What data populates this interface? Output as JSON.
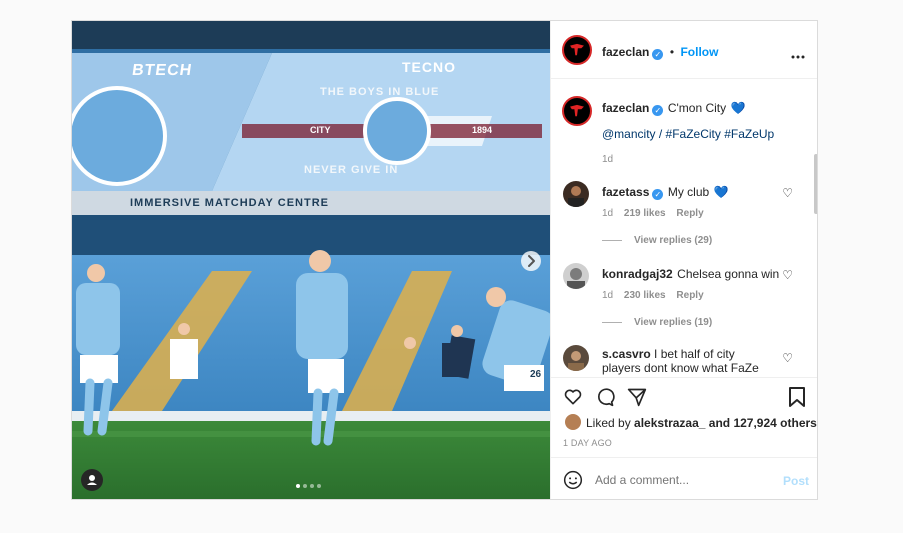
{
  "header": {
    "username": "fazeclan",
    "separator": "•",
    "follow_label": "Follow",
    "more_icon": "more-horizontal-icon"
  },
  "caption": {
    "username": "fazeclan",
    "text": "C'mon City",
    "heart": "💙",
    "tags": "@mancity / #FaZeCity #FaZeUp",
    "time": "1d"
  },
  "comments": [
    {
      "username": "fazetass",
      "text": "My club",
      "heart": "💙",
      "time": "1d",
      "likes": "219 likes",
      "reply": "Reply",
      "view_replies": "View replies (29)"
    },
    {
      "username": "konradgaj32",
      "text": "Chelsea gonna win",
      "time": "1d",
      "likes": "230 likes",
      "reply": "Reply",
      "view_replies": "View replies (19)"
    },
    {
      "username": "s.casvro",
      "text": "I bet half of city players dont know what FaZe clan is"
    }
  ],
  "likes": {
    "prefix": "Liked by",
    "user": "alekstrazaa_",
    "suffix": "and 127,924 others"
  },
  "timestamp": "1 DAY AGO",
  "add_comment": {
    "placeholder": "Add a comment...",
    "post_label": "Post"
  },
  "media": {
    "stand_banner_left": "BTECH",
    "stand_banner_right": "TECNO",
    "stand_text_1": "THE BOYS IN BLUE",
    "stand_text_2": "CITY",
    "stand_text_3": "1894",
    "stand_text_4": "NEVER GIVE IN",
    "board_text": "IMMERSIVE MATCHDAY CENTRE",
    "jersey_number": "26",
    "next_icon": "chevron-right-icon",
    "user_tag_icon": "user-tag-icon",
    "carousel_count": 4,
    "carousel_active": 1
  },
  "colors": {
    "accent": "#0095f6",
    "verified": "#3897f0",
    "heart_blue": "#1f6fd1",
    "city_blue": "#6cabdd"
  }
}
